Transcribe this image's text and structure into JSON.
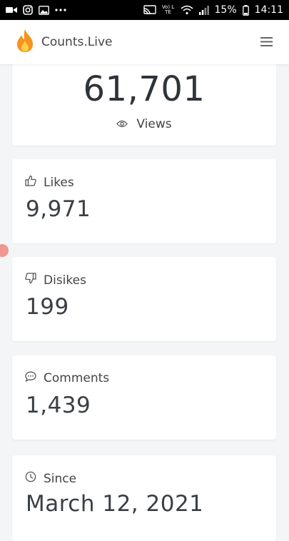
{
  "status_bar": {
    "battery_percent": "15%",
    "time": "14:11",
    "network_label": "Vo) LTE"
  },
  "app_bar": {
    "brand_name": "Counts.Live"
  },
  "views": {
    "value": "61,701",
    "label": "Views"
  },
  "stats": [
    {
      "label": "Likes",
      "value": "9,971"
    },
    {
      "label": "Disikes",
      "value": "199"
    },
    {
      "label": "Comments",
      "value": "1,439"
    }
  ],
  "since": {
    "label": "Since",
    "value": "March 12, 2021"
  },
  "colors": {
    "page_background": "#f4f5f7",
    "card_background": "#ffffff",
    "brand_flame": "#f7931e",
    "text": "#3a3f44"
  }
}
